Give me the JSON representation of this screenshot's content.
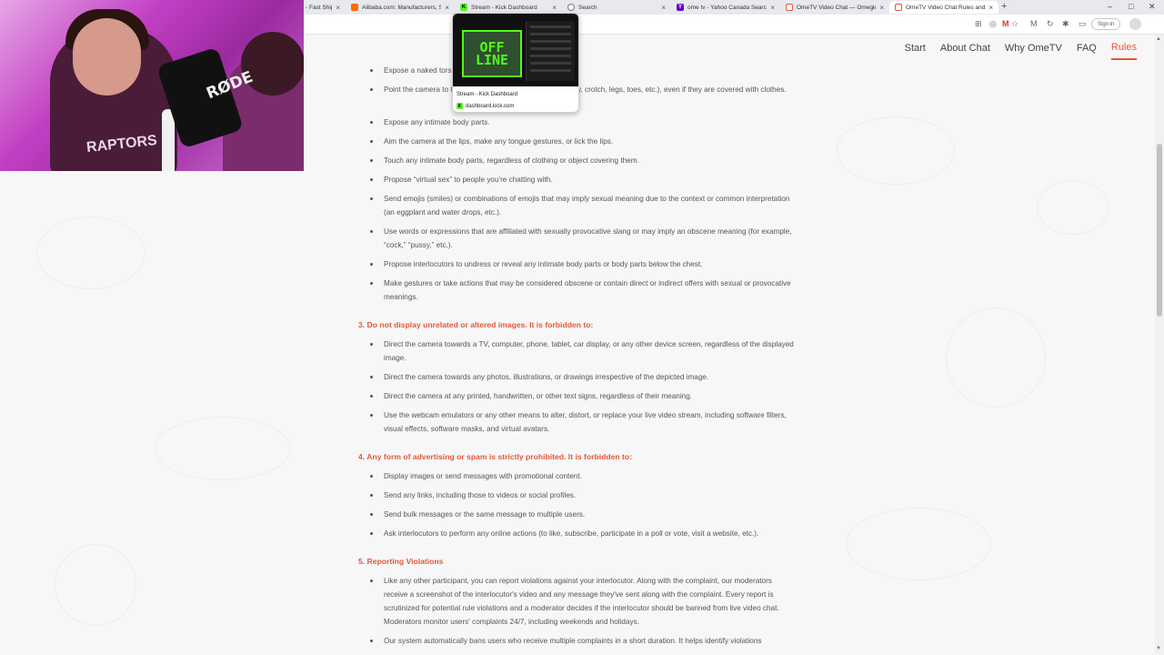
{
  "browser": {
    "tabs": [
      {
        "title": "- Fast Ship",
        "favicon_color": "#2c2c2c"
      },
      {
        "title": "Alibaba.com: Manufacturers, Sup",
        "favicon_color": "#ff6a00"
      },
      {
        "title": "Stream - Kick Dashboard",
        "favicon_color": "#53fc18"
      },
      {
        "title": "Search",
        "favicon_color": "#6b6b6b"
      },
      {
        "title": "ome tv - Yahoo Canada Search R",
        "favicon_color": "#6001d2"
      },
      {
        "title": "OmeTV Video Chat — Omegle R",
        "favicon_color": "#e05a3a"
      },
      {
        "title": "OmeTV Video Chat Rules and Re",
        "favicon_color": "#e05a3a"
      }
    ],
    "new_tab": "+",
    "sign_in_label": "Sign in",
    "window_controls": [
      "–",
      "□",
      "✕"
    ]
  },
  "tab_preview": {
    "title": "Stream - Kick Dashboard",
    "url": "dashboard.kick.com",
    "thumbnail_text": "OFF LINE"
  },
  "webcam": {
    "mic_label": "RØDE",
    "shirt_text": "RAPTORS"
  },
  "site_nav": [
    "Start",
    "About Chat",
    "Why OmeTV",
    "FAQ",
    "Rules"
  ],
  "site_nav_active": "Rules",
  "accent_color": "#e05a3a",
  "rules": {
    "section2_items": [
      "Expose a naked torso.",
      "Point the camera to the lower body parts (including the belly, crotch, legs, toes, etc.), even if they are covered with clothes.",
      "Expose any intimate body parts.",
      "Aim the camera at the lips, make any tongue gestures, or lick the lips.",
      "Touch any intimate body parts, regardless of clothing or object covering them.",
      "Propose “virtual sex” to people you're chatting with.",
      "Send emojis (smiles) or combinations of emojis that may imply sexual meaning due to the context or common interpretation (an eggplant and water drops, etc.).",
      "Use words or expressions that are affiliated with sexually provocative slang or may imply an obscene meaning (for example, “cock,” “pussy,” etc.).",
      "Propose interlocutors to undress or reveal any intimate body parts or body parts below the chest.",
      "Make gestures or take actions that may be considered obscene or contain direct or indirect offers with sexual or provocative meanings."
    ],
    "section3_title": "3. Do not display unrelated or altered images. It is forbidden to:",
    "section3_items": [
      "Direct the camera towards a TV, computer, phone, tablet, car display, or any other device screen, regardless of the displayed image.",
      "Direct the camera towards any photos, illustrations, or drawings irrespective of the depicted image.",
      "Direct the camera at any printed, handwritten, or other text signs, regardless of their meaning.",
      "Use the webcam emulators or any other means to alter, distort, or replace your live video stream, including software filters, visual effects, software masks, and virtual avatars."
    ],
    "section4_title": "4. Any form of advertising or spam is strictly prohibited. It is forbidden to:",
    "section4_items": [
      "Display images or send messages with promotional content.",
      "Send any links, including those to videos or social profiles.",
      "Send bulk messages or the same message to multiple users.",
      "Ask interlocutors to perform any online actions (to like, subscribe, participate in a poll or vote, visit a website, etc.)."
    ],
    "section5_title": "5. Reporting Violations",
    "section5_items": [
      "Like any other participant, you can report violations against your interlocutor. Along with the complaint, our moderators receive a screenshot of the interlocutor's video and any message they've sent along with the complaint. Every report is scrutinized for potential rule violations and a moderator decides if the interlocutor should be banned from live video chat. Moderators monitor users' complaints 24/7, including weekends and holidays.",
      "Our system automatically bans users who receive multiple complaints in a short duration. It helps identify violations"
    ]
  }
}
